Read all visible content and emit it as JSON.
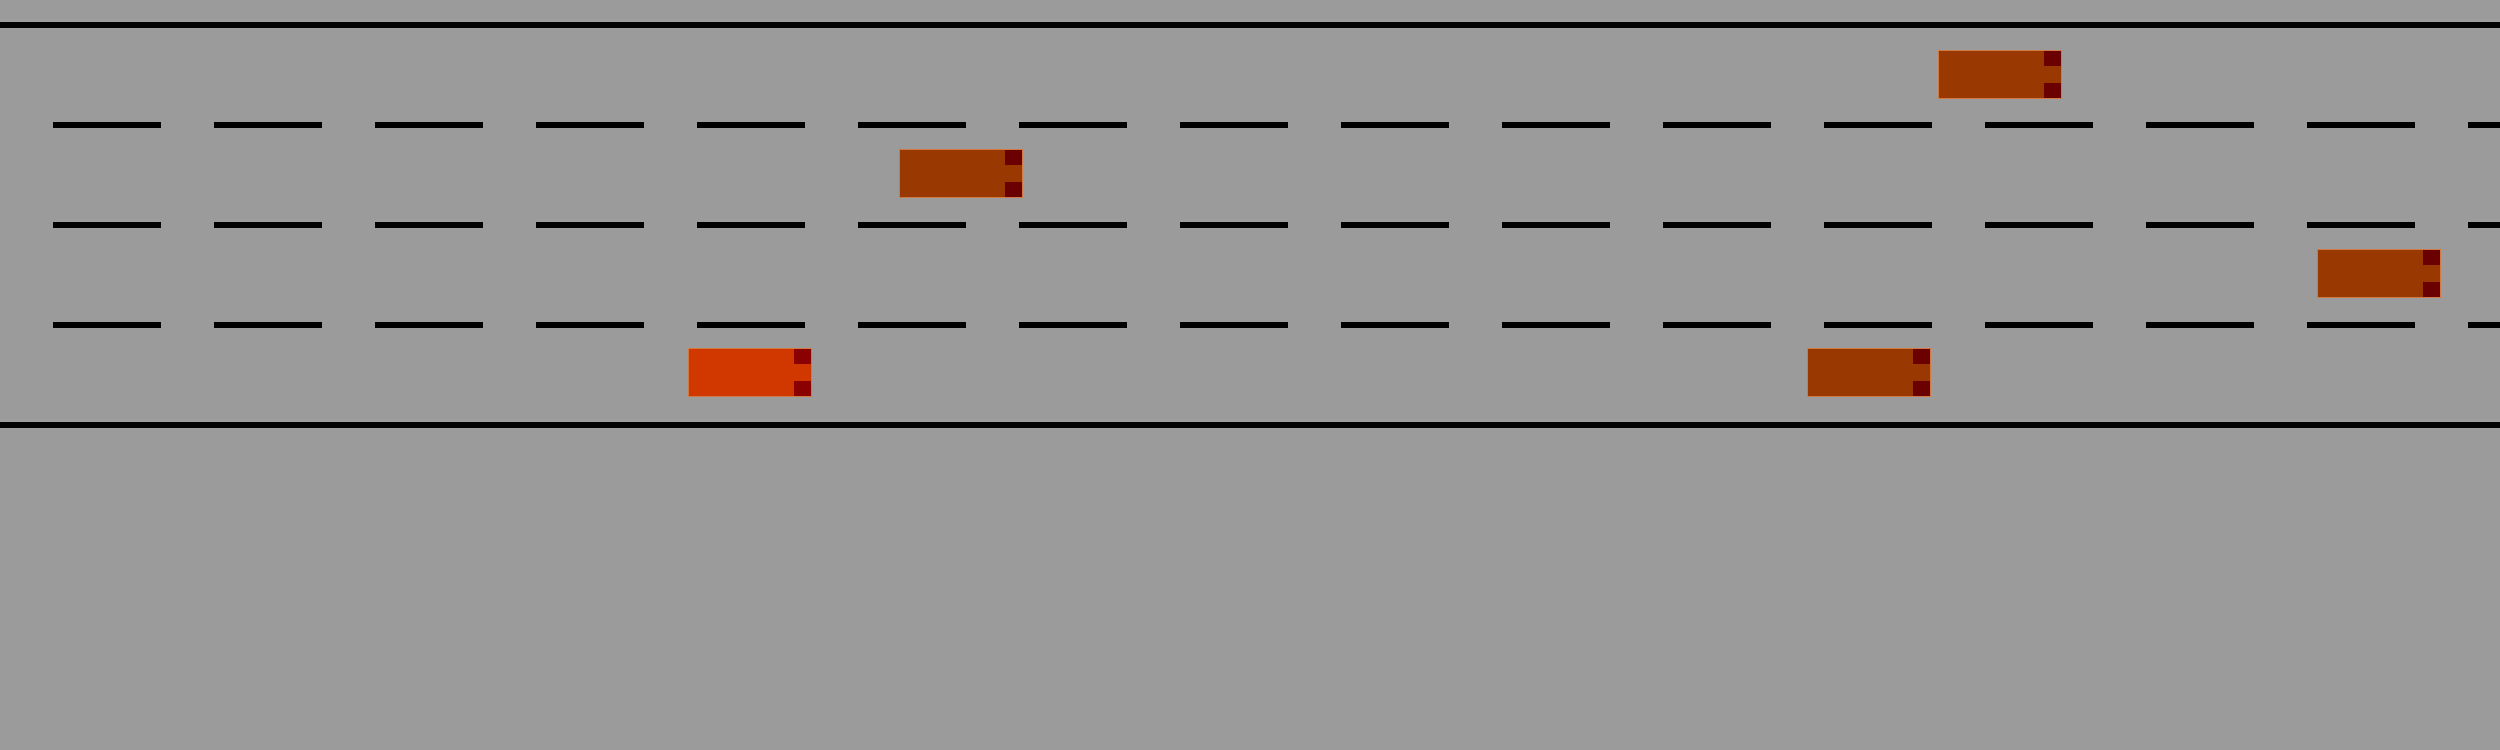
{
  "game": {
    "road": {
      "edge_color": "#000000",
      "surface_color": "#9b9b9b",
      "lane_count": 4
    },
    "vehicles": [
      {
        "id": "ego",
        "role": "player",
        "lane": 4,
        "body_color": "#d03800",
        "light_color": "#8b0000"
      },
      {
        "id": "npc-1",
        "role": "traffic",
        "lane": 1,
        "body_color": "#993800",
        "light_color": "#6b0000"
      },
      {
        "id": "npc-2",
        "role": "traffic",
        "lane": 2,
        "body_color": "#993800",
        "light_color": "#6b0000"
      },
      {
        "id": "npc-3",
        "role": "traffic",
        "lane": 3,
        "body_color": "#993800",
        "light_color": "#6b0000"
      },
      {
        "id": "npc-4",
        "role": "traffic",
        "lane": 4,
        "body_color": "#993800",
        "light_color": "#6b0000"
      }
    ]
  }
}
